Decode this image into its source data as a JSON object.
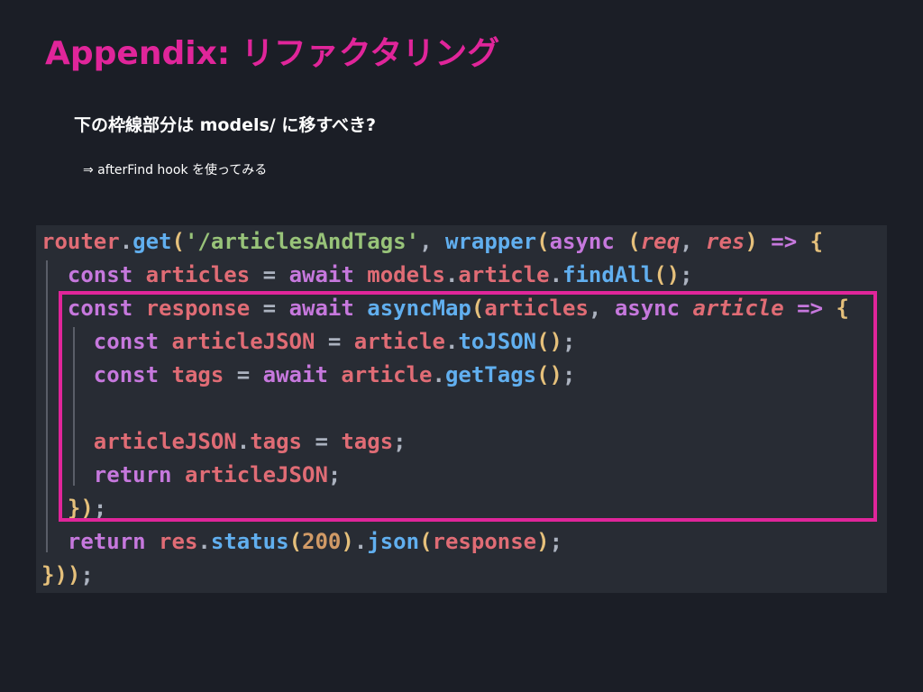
{
  "slide": {
    "title": "Appendix: リファクタリング",
    "question": "下の枠線部分は models/ に移すべき?",
    "answer": "⇒ afterFind hook を使ってみる"
  },
  "colors": {
    "accent": "#e0259a",
    "background": "#1b1e26",
    "code_background": "#282c34",
    "keyword": "#c678dd",
    "variable": "#e06c75",
    "function": "#61afef",
    "string": "#98c379",
    "number": "#d19a66",
    "punctuation": "#abb2bf",
    "bracket": "#e5c07b"
  },
  "code": {
    "lines": [
      [
        {
          "t": "router",
          "c": "variable"
        },
        {
          "t": ".",
          "c": "punctuation"
        },
        {
          "t": "get",
          "c": "function"
        },
        {
          "t": "(",
          "c": "bracket"
        },
        {
          "t": "'/articlesAndTags'",
          "c": "string"
        },
        {
          "t": ", ",
          "c": "punctuation"
        },
        {
          "t": "wrapper",
          "c": "function"
        },
        {
          "t": "(",
          "c": "bracket"
        },
        {
          "t": "async",
          "c": "keyword"
        },
        {
          "t": " ",
          "c": "punctuation"
        },
        {
          "t": "(",
          "c": "bracket"
        },
        {
          "t": "req",
          "c": "variable",
          "i": true
        },
        {
          "t": ", ",
          "c": "punctuation"
        },
        {
          "t": "res",
          "c": "variable",
          "i": true
        },
        {
          "t": ")",
          "c": "bracket"
        },
        {
          "t": " => ",
          "c": "keyword"
        },
        {
          "t": "{",
          "c": "bracket"
        }
      ],
      [
        {
          "t": "  ",
          "c": "punctuation"
        },
        {
          "t": "const",
          "c": "keyword"
        },
        {
          "t": " articles",
          "c": "variable"
        },
        {
          "t": " = ",
          "c": "punctuation"
        },
        {
          "t": "await",
          "c": "keyword"
        },
        {
          "t": " models",
          "c": "variable"
        },
        {
          "t": ".",
          "c": "punctuation"
        },
        {
          "t": "article",
          "c": "variable"
        },
        {
          "t": ".",
          "c": "punctuation"
        },
        {
          "t": "findAll",
          "c": "function"
        },
        {
          "t": "()",
          "c": "bracket"
        },
        {
          "t": ";",
          "c": "punctuation"
        }
      ],
      [
        {
          "t": "  ",
          "c": "punctuation"
        },
        {
          "t": "const",
          "c": "keyword"
        },
        {
          "t": " response",
          "c": "variable"
        },
        {
          "t": " = ",
          "c": "punctuation"
        },
        {
          "t": "await",
          "c": "keyword"
        },
        {
          "t": " asyncMap",
          "c": "function"
        },
        {
          "t": "(",
          "c": "bracket"
        },
        {
          "t": "articles",
          "c": "variable"
        },
        {
          "t": ", ",
          "c": "punctuation"
        },
        {
          "t": "async",
          "c": "keyword"
        },
        {
          "t": " ",
          "c": "punctuation"
        },
        {
          "t": "article",
          "c": "variable",
          "i": true
        },
        {
          "t": " => ",
          "c": "keyword"
        },
        {
          "t": "{",
          "c": "bracket"
        }
      ],
      [
        {
          "t": "    ",
          "c": "punctuation"
        },
        {
          "t": "const",
          "c": "keyword"
        },
        {
          "t": " articleJSON",
          "c": "variable"
        },
        {
          "t": " = ",
          "c": "punctuation"
        },
        {
          "t": "article",
          "c": "variable"
        },
        {
          "t": ".",
          "c": "punctuation"
        },
        {
          "t": "toJSON",
          "c": "function"
        },
        {
          "t": "()",
          "c": "bracket"
        },
        {
          "t": ";",
          "c": "punctuation"
        }
      ],
      [
        {
          "t": "    ",
          "c": "punctuation"
        },
        {
          "t": "const",
          "c": "keyword"
        },
        {
          "t": " tags",
          "c": "variable"
        },
        {
          "t": " = ",
          "c": "punctuation"
        },
        {
          "t": "await",
          "c": "keyword"
        },
        {
          "t": " article",
          "c": "variable"
        },
        {
          "t": ".",
          "c": "punctuation"
        },
        {
          "t": "getTags",
          "c": "function"
        },
        {
          "t": "()",
          "c": "bracket"
        },
        {
          "t": ";",
          "c": "punctuation"
        }
      ],
      [],
      [
        {
          "t": "    ",
          "c": "punctuation"
        },
        {
          "t": "articleJSON",
          "c": "variable"
        },
        {
          "t": ".",
          "c": "punctuation"
        },
        {
          "t": "tags",
          "c": "variable"
        },
        {
          "t": " = ",
          "c": "punctuation"
        },
        {
          "t": "tags",
          "c": "variable"
        },
        {
          "t": ";",
          "c": "punctuation"
        }
      ],
      [
        {
          "t": "    ",
          "c": "punctuation"
        },
        {
          "t": "return",
          "c": "keyword"
        },
        {
          "t": " articleJSON",
          "c": "variable"
        },
        {
          "t": ";",
          "c": "punctuation"
        }
      ],
      [
        {
          "t": "  ",
          "c": "punctuation"
        },
        {
          "t": "}",
          "c": "bracket"
        },
        {
          "t": ")",
          "c": "bracket"
        },
        {
          "t": ";",
          "c": "punctuation"
        }
      ],
      [
        {
          "t": "  ",
          "c": "punctuation"
        },
        {
          "t": "return",
          "c": "keyword"
        },
        {
          "t": " res",
          "c": "variable"
        },
        {
          "t": ".",
          "c": "punctuation"
        },
        {
          "t": "status",
          "c": "function"
        },
        {
          "t": "(",
          "c": "bracket"
        },
        {
          "t": "200",
          "c": "number"
        },
        {
          "t": ")",
          "c": "bracket"
        },
        {
          "t": ".",
          "c": "punctuation"
        },
        {
          "t": "json",
          "c": "function"
        },
        {
          "t": "(",
          "c": "bracket"
        },
        {
          "t": "response",
          "c": "variable"
        },
        {
          "t": ")",
          "c": "bracket"
        },
        {
          "t": ";",
          "c": "punctuation"
        }
      ],
      [
        {
          "t": "}",
          "c": "bracket"
        },
        {
          "t": "))",
          "c": "bracket"
        },
        {
          "t": ";",
          "c": "punctuation"
        }
      ]
    ]
  }
}
